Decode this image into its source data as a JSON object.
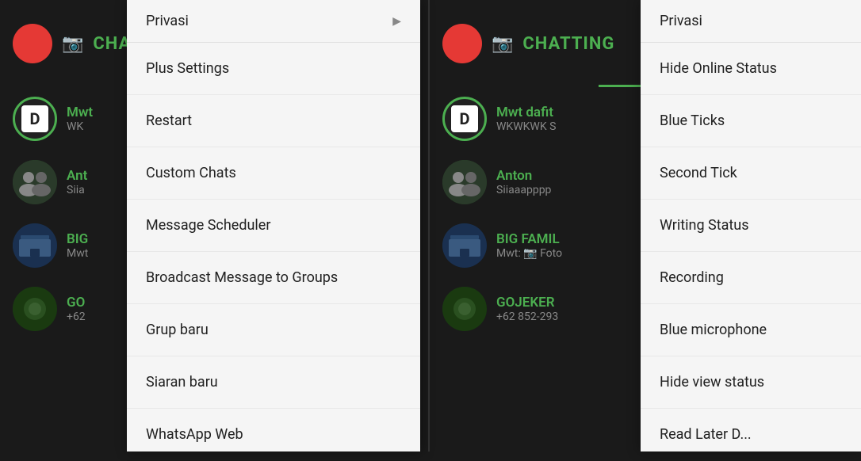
{
  "left_panel": {
    "header": {
      "title": "CHATTI",
      "camera_icon": "📷"
    },
    "chat_items": [
      {
        "id": "mwt",
        "name": "Mwt",
        "preview": "WK",
        "avatar_type": "d_letter"
      },
      {
        "id": "ant",
        "name": "Ant",
        "preview": "Siia",
        "avatar_type": "group1"
      },
      {
        "id": "big",
        "name": "BIG",
        "preview": "Mwt",
        "avatar_type": "group2"
      },
      {
        "id": "go",
        "name": "GO",
        "preview": "+62",
        "avatar_type": "group3"
      }
    ],
    "dropdown": {
      "privasi_label": "Privasi",
      "items": [
        {
          "id": "plus-settings",
          "label": "Plus Settings",
          "has_arrow": false
        },
        {
          "id": "restart",
          "label": "Restart",
          "has_arrow": false
        },
        {
          "id": "custom-chats",
          "label": "Custom Chats",
          "has_arrow": false
        },
        {
          "id": "message-scheduler",
          "label": "Message Scheduler",
          "has_arrow": false
        },
        {
          "id": "broadcast",
          "label": "Broadcast Message to Groups",
          "has_arrow": false
        },
        {
          "id": "grup-baru",
          "label": "Grup baru",
          "has_arrow": false
        },
        {
          "id": "siaran-baru",
          "label": "Siaran baru",
          "has_arrow": false
        },
        {
          "id": "whatsapp-web",
          "label": "WhatsApp Web",
          "has_arrow": false
        }
      ]
    }
  },
  "right_panel": {
    "header": {
      "title": "CHATTING",
      "camera_icon": "📷"
    },
    "chat_items": [
      {
        "id": "mwt-dafit",
        "name": "Mwt dafit",
        "preview": "WKWKWK S",
        "avatar_type": "d_letter"
      },
      {
        "id": "anton",
        "name": "Anton",
        "preview": "Siiaaapppp",
        "avatar_type": "group1"
      },
      {
        "id": "big-family",
        "name": "BIG FAMIL",
        "preview": "Mwt: 📷 Foto",
        "avatar_type": "group2"
      },
      {
        "id": "gojeker",
        "name": "GOJEKER",
        "preview": "+62 852-293",
        "avatar_type": "group3"
      }
    ],
    "right_dropdown": {
      "privasi_label": "Privasi",
      "items": [
        {
          "id": "hide-online",
          "label": "Hide Online Status"
        },
        {
          "id": "blue-ticks",
          "label": "Blue Ticks"
        },
        {
          "id": "second-tick",
          "label": "Second Tick"
        },
        {
          "id": "writing-status",
          "label": "Writing Status"
        },
        {
          "id": "recording",
          "label": "Recording"
        },
        {
          "id": "blue-microphone",
          "label": "Blue microphone"
        },
        {
          "id": "hide-view-status",
          "label": "Hide view status"
        },
        {
          "id": "read-later",
          "label": "Read Later D..."
        }
      ]
    }
  }
}
